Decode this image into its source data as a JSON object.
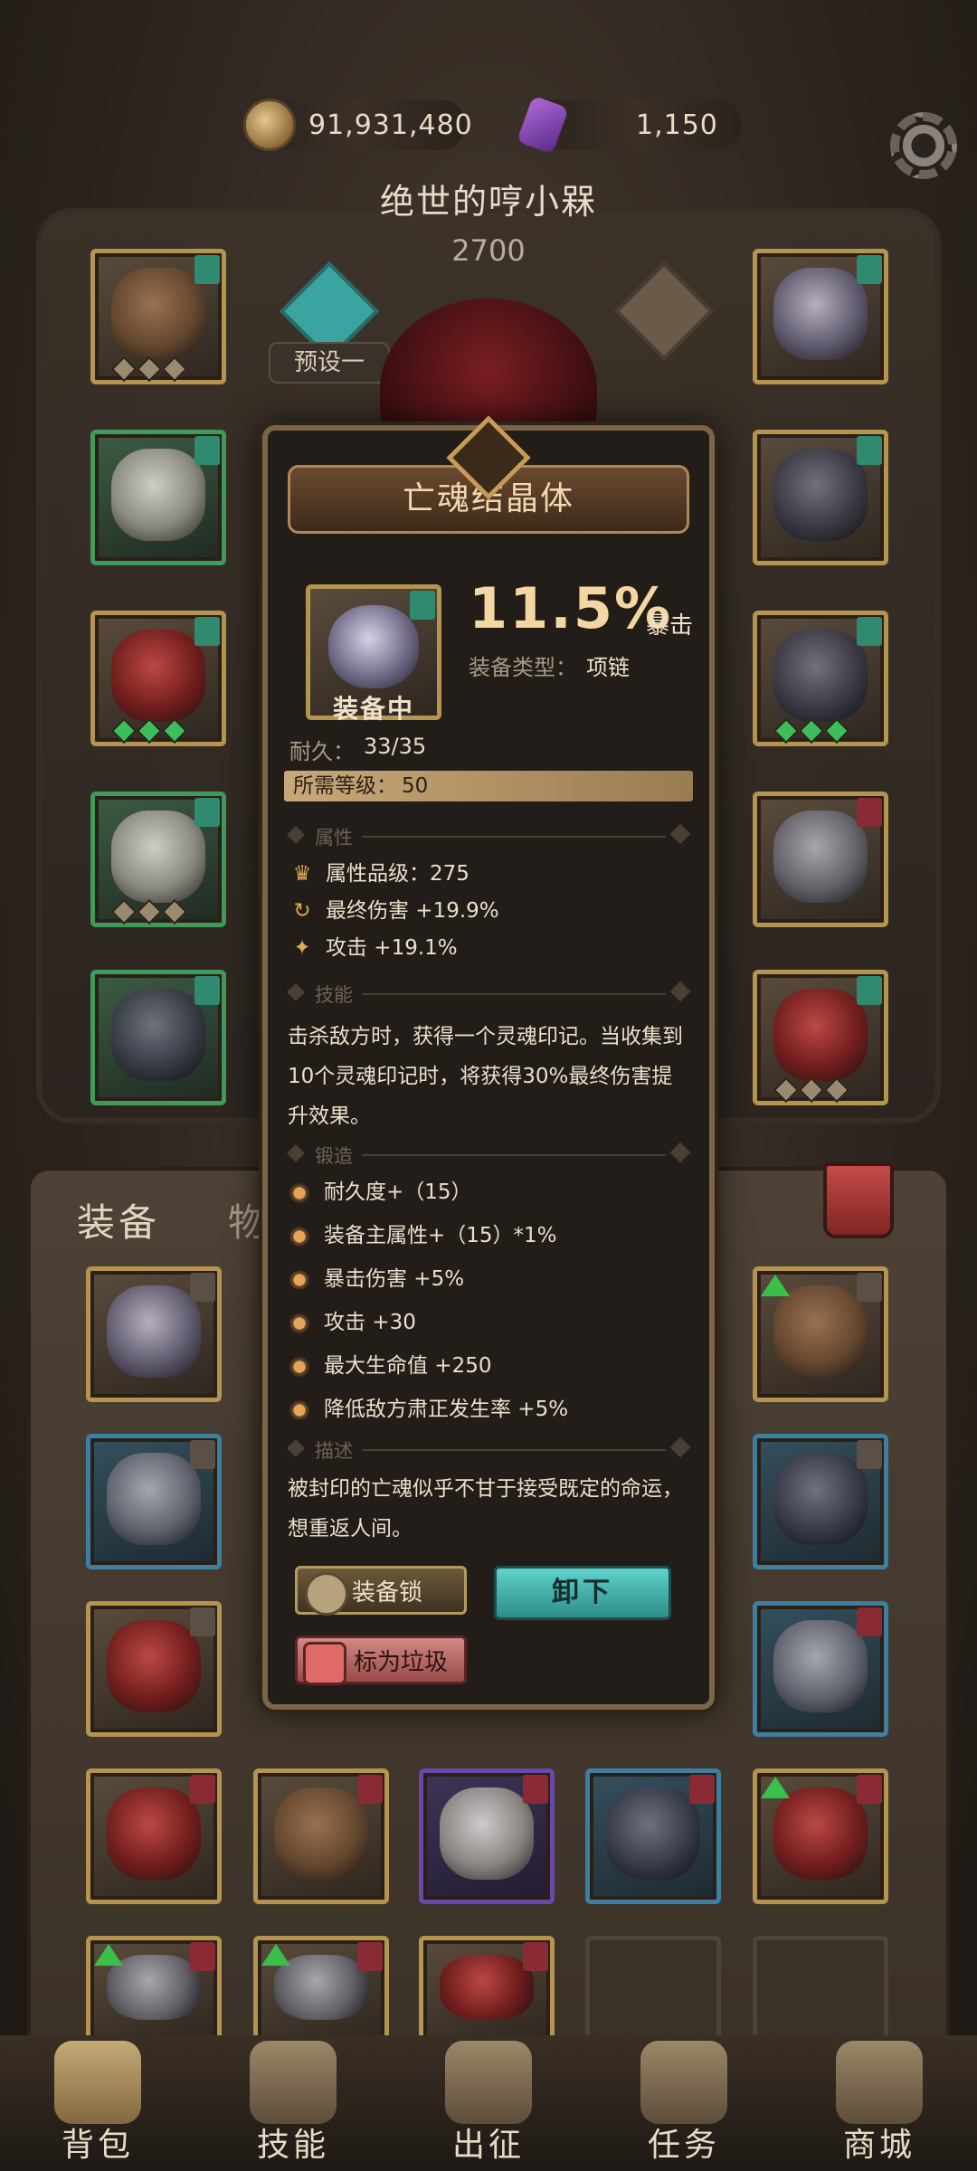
{
  "currency": {
    "gold": "91,931,480",
    "gems": "1,150"
  },
  "player": {
    "name": "绝世的哼小槑",
    "power": "2700"
  },
  "preset": {
    "label": "预设一"
  },
  "inventory": {
    "tab_equip": "装备",
    "tab_items": "物品"
  },
  "nav": [
    {
      "label": "背包",
      "icon": "backpack-icon"
    },
    {
      "label": "技能",
      "icon": "skill-book-icon"
    },
    {
      "label": "出征",
      "icon": "battle-map-icon"
    },
    {
      "label": "任务",
      "icon": "quest-scroll-icon"
    },
    {
      "label": "商城",
      "icon": "shop-crest-icon"
    }
  ],
  "popup": {
    "title": "亡魂结晶体",
    "status": "装备中",
    "main_stat_value": "11.5%",
    "main_stat_label": "暴击",
    "equip_type_label": "装备类型：",
    "equip_type_value": "项链",
    "durability_label": "耐久：",
    "durability_value": "33/35",
    "required_level_label": "所需等级：",
    "required_level_value": "50",
    "sections": {
      "attributes": "属性",
      "skill": "技能",
      "forge": "锻造",
      "description": "描述"
    },
    "attributes": [
      {
        "icon": "quality-crest-icon",
        "text": "属性品级：275"
      },
      {
        "icon": "damage-cycle-icon",
        "text": "最终伤害 +19.9%"
      },
      {
        "icon": "attack-star-icon",
        "text": "攻击 +19.1%"
      }
    ],
    "skill_text": "击杀敌方时，获得一个灵魂印记。当收集到10个灵魂印记时，将获得30%最终伤害提升效果。",
    "forge": [
      "耐久度+（15）",
      "装备主属性+（15）*1%",
      "暴击伤害 +5%",
      "攻击 +30",
      "最大生命值 +250",
      "降低敌方肃正发生率 +5%"
    ],
    "description": "被封印的亡魂似乎不甘于接受既定的命运，想重返人间。",
    "buttons": {
      "lock": "装备锁",
      "unequip": "卸下",
      "junk": "标为垃圾"
    }
  }
}
